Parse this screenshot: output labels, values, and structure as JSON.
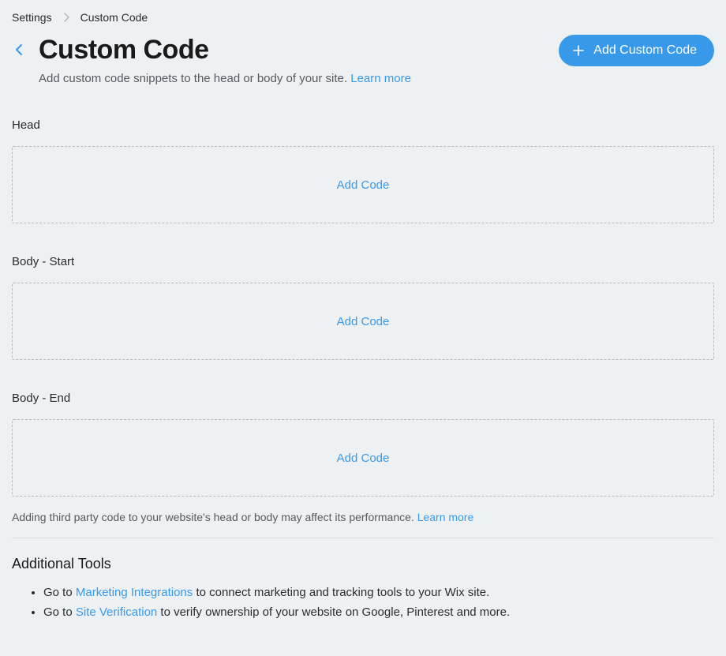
{
  "breadcrumb": {
    "root": "Settings",
    "current": "Custom Code"
  },
  "header": {
    "title": "Custom Code",
    "subtitle_prefix": "Add custom code snippets to the head or body of your site. ",
    "learn_more": "Learn more",
    "add_button": "Add Custom Code"
  },
  "sections": {
    "head": {
      "title": "Head",
      "cta": "Add Code"
    },
    "body_start": {
      "title": "Body - Start",
      "cta": "Add Code"
    },
    "body_end": {
      "title": "Body - End",
      "cta": "Add Code"
    }
  },
  "footer_note": {
    "text": "Adding third party code to your website's head or body may affect its performance. ",
    "learn_more": "Learn more"
  },
  "tools": {
    "heading": "Additional Tools",
    "items": [
      {
        "prefix": "Go to ",
        "link": "Marketing Integrations",
        "suffix": " to connect marketing and tracking tools to your Wix site."
      },
      {
        "prefix": "Go to ",
        "link": "Site Verification",
        "suffix": " to verify ownership of your website on Google, Pinterest and more."
      }
    ]
  }
}
